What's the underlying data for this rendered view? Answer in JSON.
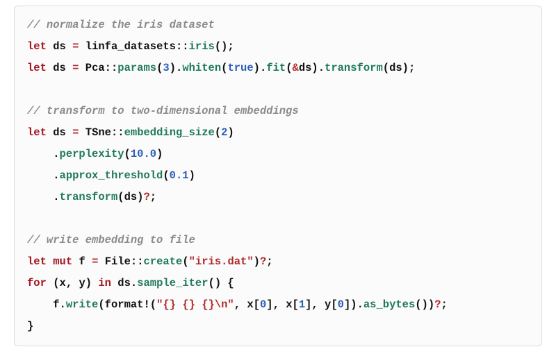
{
  "code": {
    "lines": [
      {
        "indent": 0,
        "tokens": [
          {
            "cls": "comment",
            "t": "// normalize the iris dataset"
          }
        ]
      },
      {
        "indent": 0,
        "tokens": [
          {
            "cls": "keyword",
            "t": "let"
          },
          {
            "cls": "punct",
            "t": " "
          },
          {
            "cls": "ident",
            "t": "ds"
          },
          {
            "cls": "punct",
            "t": " "
          },
          {
            "cls": "op",
            "t": "="
          },
          {
            "cls": "punct",
            "t": " "
          },
          {
            "cls": "ident",
            "t": "linfa_datasets"
          },
          {
            "cls": "punct",
            "t": "::"
          },
          {
            "cls": "method",
            "t": "iris"
          },
          {
            "cls": "punct",
            "t": "();"
          }
        ]
      },
      {
        "indent": 0,
        "tokens": [
          {
            "cls": "keyword",
            "t": "let"
          },
          {
            "cls": "punct",
            "t": " "
          },
          {
            "cls": "ident",
            "t": "ds"
          },
          {
            "cls": "punct",
            "t": " "
          },
          {
            "cls": "op",
            "t": "="
          },
          {
            "cls": "punct",
            "t": " "
          },
          {
            "cls": "type",
            "t": "Pca"
          },
          {
            "cls": "punct",
            "t": "::"
          },
          {
            "cls": "method",
            "t": "params"
          },
          {
            "cls": "punct",
            "t": "("
          },
          {
            "cls": "num",
            "t": "3"
          },
          {
            "cls": "punct",
            "t": ")."
          },
          {
            "cls": "method",
            "t": "whiten"
          },
          {
            "cls": "punct",
            "t": "("
          },
          {
            "cls": "bool",
            "t": "true"
          },
          {
            "cls": "punct",
            "t": ")."
          },
          {
            "cls": "method",
            "t": "fit"
          },
          {
            "cls": "punct",
            "t": "("
          },
          {
            "cls": "op",
            "t": "&"
          },
          {
            "cls": "ident",
            "t": "ds"
          },
          {
            "cls": "punct",
            "t": ")."
          },
          {
            "cls": "method",
            "t": "transform"
          },
          {
            "cls": "punct",
            "t": "("
          },
          {
            "cls": "ident",
            "t": "ds"
          },
          {
            "cls": "punct",
            "t": ");"
          }
        ]
      },
      {
        "indent": 0,
        "tokens": []
      },
      {
        "indent": 0,
        "tokens": [
          {
            "cls": "comment",
            "t": "// transform to two-dimensional embeddings"
          }
        ]
      },
      {
        "indent": 0,
        "tokens": [
          {
            "cls": "keyword",
            "t": "let"
          },
          {
            "cls": "punct",
            "t": " "
          },
          {
            "cls": "ident",
            "t": "ds"
          },
          {
            "cls": "punct",
            "t": " "
          },
          {
            "cls": "op",
            "t": "="
          },
          {
            "cls": "punct",
            "t": " "
          },
          {
            "cls": "type",
            "t": "TSne"
          },
          {
            "cls": "punct",
            "t": "::"
          },
          {
            "cls": "method",
            "t": "embedding_size"
          },
          {
            "cls": "punct",
            "t": "("
          },
          {
            "cls": "num",
            "t": "2"
          },
          {
            "cls": "punct",
            "t": ")"
          }
        ]
      },
      {
        "indent": 1,
        "tokens": [
          {
            "cls": "punct",
            "t": "."
          },
          {
            "cls": "method",
            "t": "perplexity"
          },
          {
            "cls": "punct",
            "t": "("
          },
          {
            "cls": "num",
            "t": "10.0"
          },
          {
            "cls": "punct",
            "t": ")"
          }
        ]
      },
      {
        "indent": 1,
        "tokens": [
          {
            "cls": "punct",
            "t": "."
          },
          {
            "cls": "method",
            "t": "approx_threshold"
          },
          {
            "cls": "punct",
            "t": "("
          },
          {
            "cls": "num",
            "t": "0.1"
          },
          {
            "cls": "punct",
            "t": ")"
          }
        ]
      },
      {
        "indent": 1,
        "tokens": [
          {
            "cls": "punct",
            "t": "."
          },
          {
            "cls": "method",
            "t": "transform"
          },
          {
            "cls": "punct",
            "t": "("
          },
          {
            "cls": "ident",
            "t": "ds"
          },
          {
            "cls": "punct",
            "t": ")"
          },
          {
            "cls": "op",
            "t": "?"
          },
          {
            "cls": "punct",
            "t": ";"
          }
        ]
      },
      {
        "indent": 0,
        "tokens": []
      },
      {
        "indent": 0,
        "tokens": [
          {
            "cls": "comment",
            "t": "// write embedding to file"
          }
        ]
      },
      {
        "indent": 0,
        "tokens": [
          {
            "cls": "keyword",
            "t": "let"
          },
          {
            "cls": "punct",
            "t": " "
          },
          {
            "cls": "keyword",
            "t": "mut"
          },
          {
            "cls": "punct",
            "t": " "
          },
          {
            "cls": "ident",
            "t": "f"
          },
          {
            "cls": "punct",
            "t": " "
          },
          {
            "cls": "op",
            "t": "="
          },
          {
            "cls": "punct",
            "t": " "
          },
          {
            "cls": "type",
            "t": "File"
          },
          {
            "cls": "punct",
            "t": "::"
          },
          {
            "cls": "method",
            "t": "create"
          },
          {
            "cls": "punct",
            "t": "("
          },
          {
            "cls": "str",
            "t": "\"iris.dat\""
          },
          {
            "cls": "punct",
            "t": ")"
          },
          {
            "cls": "op",
            "t": "?"
          },
          {
            "cls": "punct",
            "t": ";"
          }
        ]
      },
      {
        "indent": 0,
        "tokens": [
          {
            "cls": "keyword",
            "t": "for"
          },
          {
            "cls": "punct",
            "t": " ("
          },
          {
            "cls": "ident",
            "t": "x"
          },
          {
            "cls": "punct",
            "t": ", "
          },
          {
            "cls": "ident",
            "t": "y"
          },
          {
            "cls": "punct",
            "t": ") "
          },
          {
            "cls": "keyword",
            "t": "in"
          },
          {
            "cls": "punct",
            "t": " "
          },
          {
            "cls": "ident",
            "t": "ds"
          },
          {
            "cls": "punct",
            "t": "."
          },
          {
            "cls": "method",
            "t": "sample_iter"
          },
          {
            "cls": "punct",
            "t": "() {"
          }
        ]
      },
      {
        "indent": 1,
        "tokens": [
          {
            "cls": "ident",
            "t": "f"
          },
          {
            "cls": "punct",
            "t": "."
          },
          {
            "cls": "method",
            "t": "write"
          },
          {
            "cls": "punct",
            "t": "("
          },
          {
            "cls": "ident",
            "t": "format!"
          },
          {
            "cls": "punct",
            "t": "("
          },
          {
            "cls": "str",
            "t": "\"{} {} {}\\n\""
          },
          {
            "cls": "punct",
            "t": ", "
          },
          {
            "cls": "ident",
            "t": "x"
          },
          {
            "cls": "punct",
            "t": "["
          },
          {
            "cls": "num",
            "t": "0"
          },
          {
            "cls": "punct",
            "t": "], "
          },
          {
            "cls": "ident",
            "t": "x"
          },
          {
            "cls": "punct",
            "t": "["
          },
          {
            "cls": "num",
            "t": "1"
          },
          {
            "cls": "punct",
            "t": "], "
          },
          {
            "cls": "ident",
            "t": "y"
          },
          {
            "cls": "punct",
            "t": "["
          },
          {
            "cls": "num",
            "t": "0"
          },
          {
            "cls": "punct",
            "t": "])."
          },
          {
            "cls": "method",
            "t": "as_bytes"
          },
          {
            "cls": "punct",
            "t": "())"
          },
          {
            "cls": "op",
            "t": "?"
          },
          {
            "cls": "punct",
            "t": ";"
          }
        ]
      },
      {
        "indent": 0,
        "tokens": [
          {
            "cls": "punct",
            "t": "}"
          }
        ]
      }
    ]
  }
}
